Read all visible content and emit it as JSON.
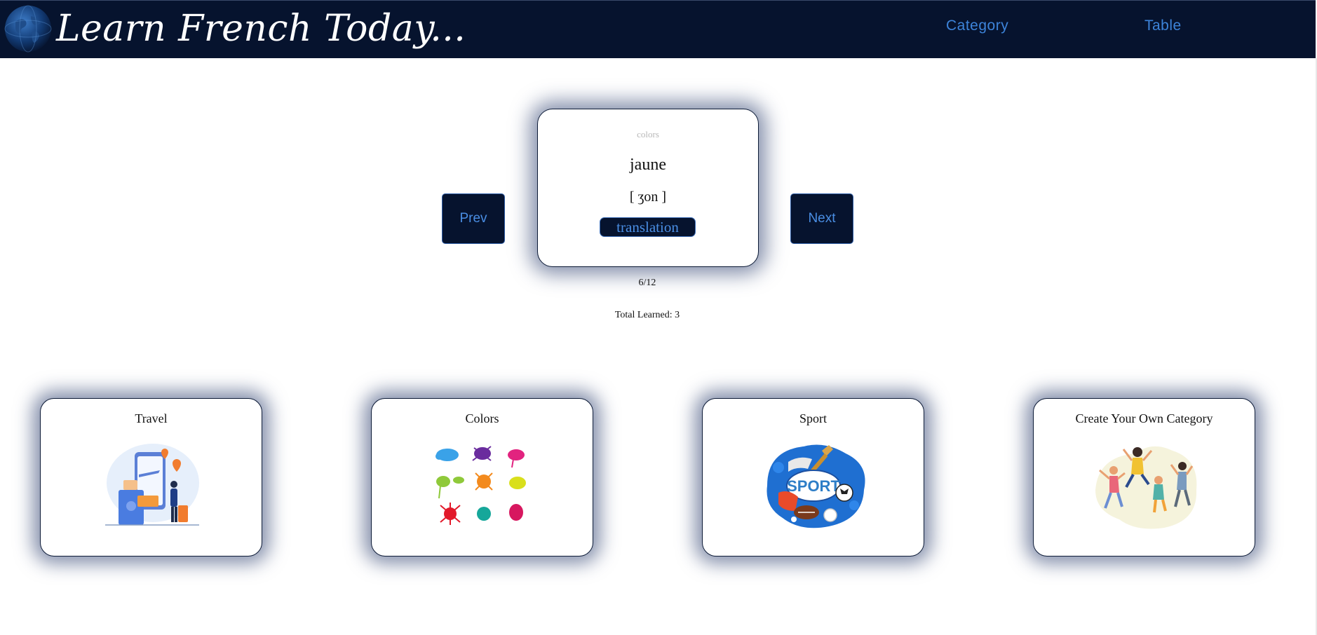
{
  "header": {
    "brand": "Learn French Today...",
    "nav": {
      "category": "Category",
      "table": "Table"
    }
  },
  "flashcard": {
    "category": "colors",
    "word": "jaune",
    "pronunciation": "[ ʒon ]",
    "translate_label": "translation",
    "prev_label": "Prev",
    "next_label": "Next",
    "progress": "6/12",
    "total_learned": "Total Learned: 3"
  },
  "categories": [
    {
      "title": "Travel",
      "icon": "travel-illustration"
    },
    {
      "title": "Colors",
      "icon": "paint-splatter-illustration"
    },
    {
      "title": "Sport",
      "icon": "sport-equipment-illustration"
    },
    {
      "title": "Create Your Own Category",
      "icon": "jumping-people-illustration"
    }
  ],
  "colors": {
    "header_bg": "#06132e",
    "accent": "#3d84da",
    "card_border": "#0c1a36"
  }
}
